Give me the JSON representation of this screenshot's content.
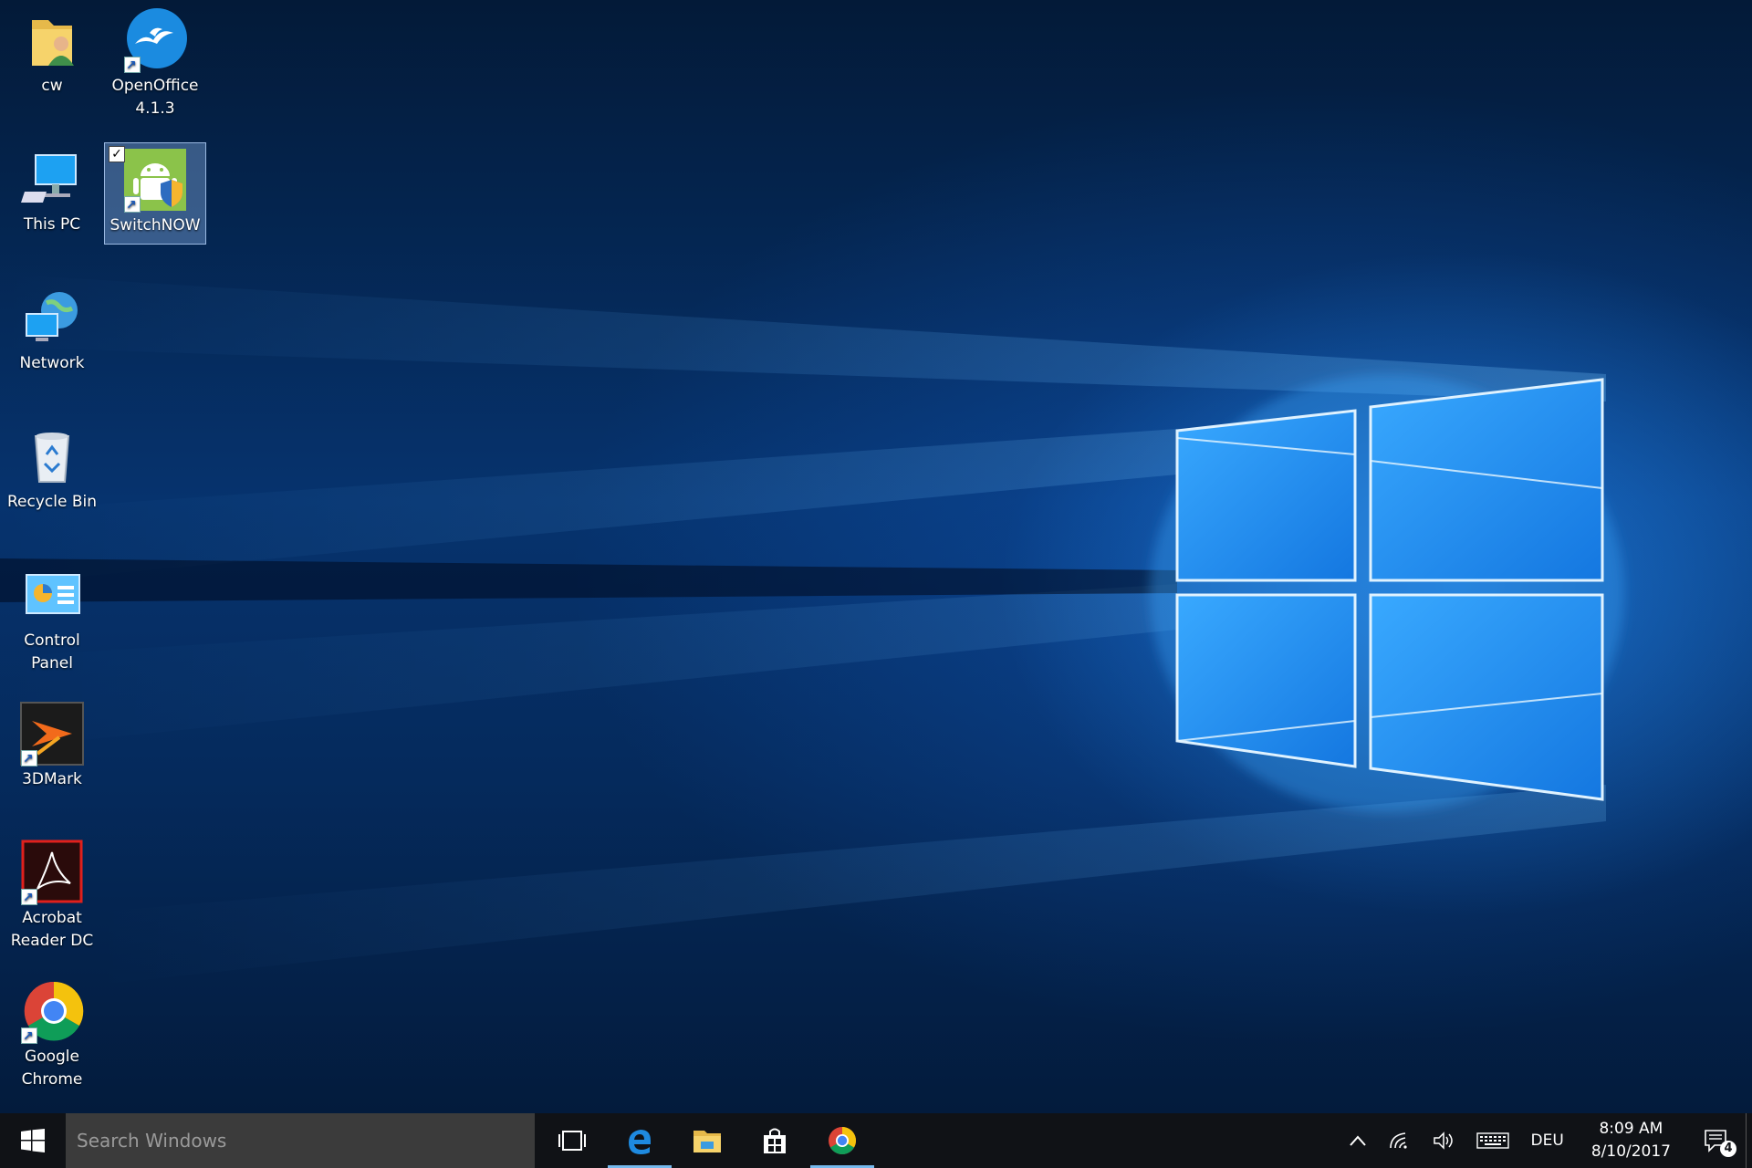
{
  "desktop": {
    "icons": [
      {
        "label": "cw",
        "icon": "user-folder-icon"
      },
      {
        "label": "OpenOffice\n4.1.3",
        "icon": "openoffice-icon"
      },
      {
        "label": "This PC",
        "icon": "this-pc-icon"
      },
      {
        "label": "SwitchNOW",
        "icon": "switchnow-icon",
        "selected": true
      },
      {
        "label": "Network",
        "icon": "network-icon"
      },
      {
        "label": "Recycle Bin",
        "icon": "recycle-bin-icon"
      },
      {
        "label": "Control Panel",
        "icon": "control-panel-icon"
      },
      {
        "label": "3DMark",
        "icon": "3dmark-icon"
      },
      {
        "label": "Acrobat\nReader DC",
        "icon": "acrobat-reader-icon"
      },
      {
        "label": "Google\nChrome",
        "icon": "chrome-icon"
      }
    ]
  },
  "taskbar": {
    "search_placeholder": "Search Windows",
    "pinned": [
      {
        "icon": "task-view-icon"
      },
      {
        "icon": "edge-icon",
        "running": true
      },
      {
        "icon": "file-explorer-icon"
      },
      {
        "icon": "store-icon"
      },
      {
        "icon": "chrome-icon",
        "running": true
      }
    ],
    "tray": {
      "language": "DEU",
      "time": "8:09 AM",
      "date": "8/10/2017",
      "notification_count": "4"
    }
  },
  "colors": {
    "taskbar_bg": "#101216",
    "search_bg": "#3b3b3b",
    "accent": "#76b9ed",
    "wallpaper_light": "#3aa0ff"
  }
}
